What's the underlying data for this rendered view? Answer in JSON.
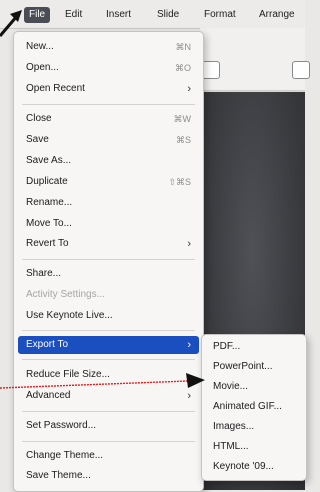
{
  "menubar": {
    "items": [
      "File",
      "Edit",
      "Insert",
      "Slide",
      "Format",
      "Arrange"
    ],
    "active": "File"
  },
  "file_menu": {
    "items": [
      {
        "label": "New...",
        "shortcut": "⌘N"
      },
      {
        "label": "Open...",
        "shortcut": "⌘O"
      },
      {
        "label": "Open Recent",
        "submenu": true
      },
      {
        "label": "Close",
        "shortcut": "⌘W"
      },
      {
        "label": "Save",
        "shortcut": "⌘S"
      },
      {
        "label": "Save As..."
      },
      {
        "label": "Duplicate",
        "shortcut": "⇧⌘S"
      },
      {
        "label": "Rename..."
      },
      {
        "label": "Move To..."
      },
      {
        "label": "Revert To",
        "submenu": true
      },
      {
        "label": "Share..."
      },
      {
        "label": "Activity Settings...",
        "disabled": true
      },
      {
        "label": "Use Keynote Live..."
      },
      {
        "label": "Export To",
        "submenu": true,
        "highlighted": true
      },
      {
        "label": "Reduce File Size..."
      },
      {
        "label": "Advanced",
        "submenu": true
      },
      {
        "label": "Set Password..."
      },
      {
        "label": "Change Theme..."
      },
      {
        "label": "Save Theme..."
      }
    ]
  },
  "export_submenu": {
    "items": [
      "PDF...",
      "PowerPoint...",
      "Movie...",
      "Animated GIF...",
      "Images...",
      "HTML...",
      "Keynote '09..."
    ]
  },
  "colors": {
    "highlight": "#1b4fc0",
    "annotation_arrow": "#e01c1c",
    "pointer_arrow": "#111111"
  }
}
